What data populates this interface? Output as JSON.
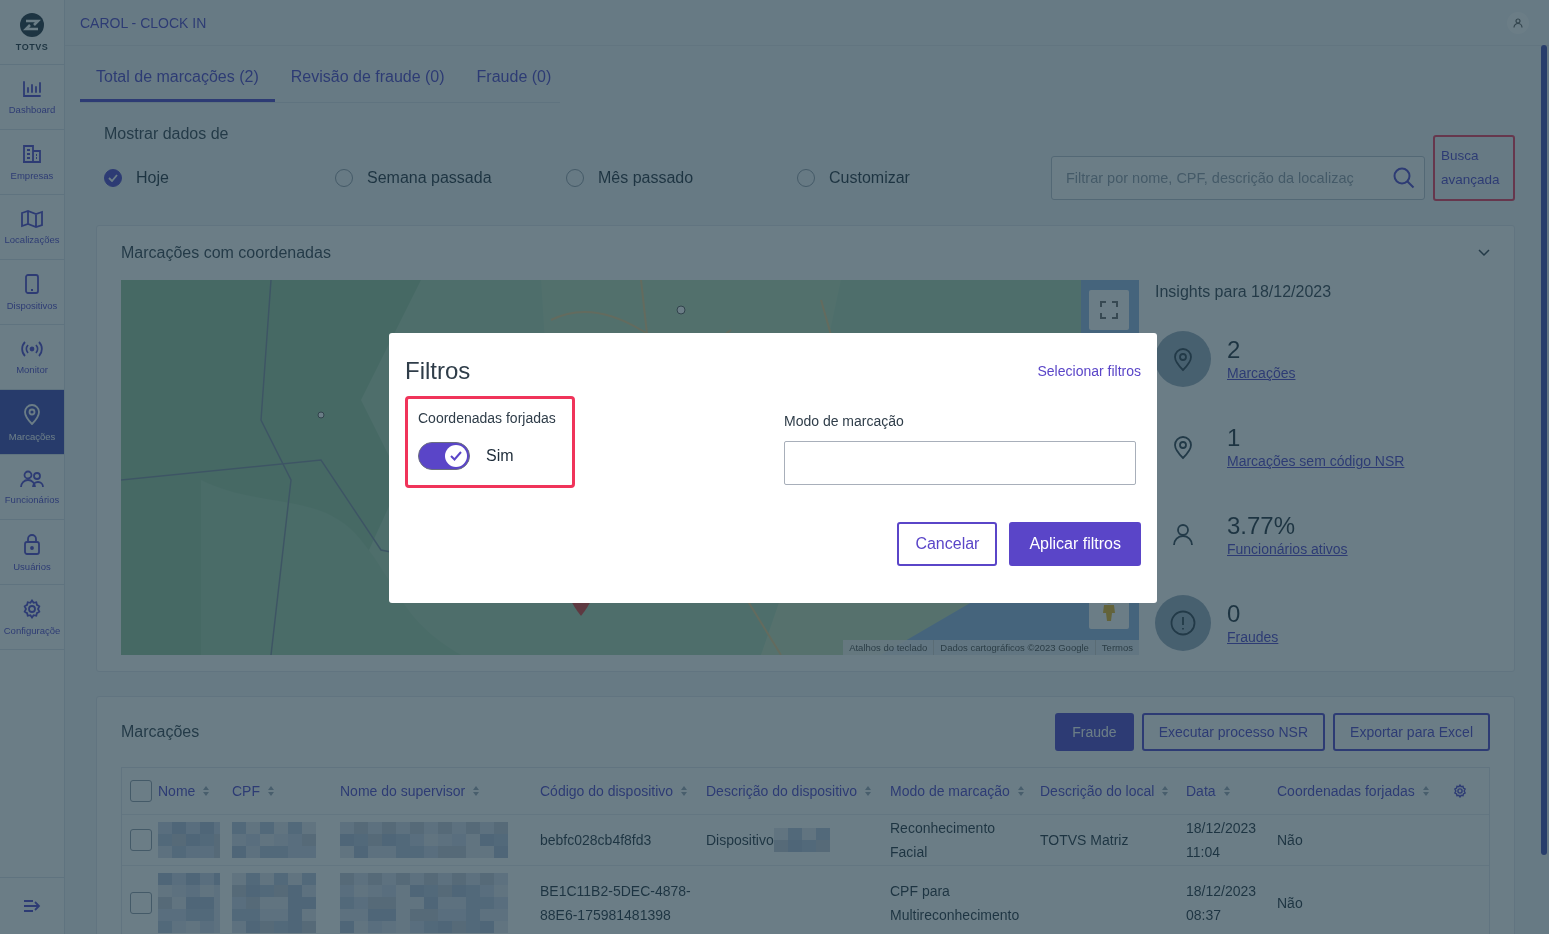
{
  "sidebar": {
    "logo": "TOTVS",
    "items": [
      {
        "label": "Dashboard",
        "kind": "chart",
        "selected": false
      },
      {
        "label": "Empresas",
        "kind": "buildings",
        "selected": false
      },
      {
        "label": "Localizações",
        "kind": "map",
        "selected": false
      },
      {
        "label": "Dispositivos",
        "kind": "phone",
        "selected": false
      },
      {
        "label": "Monitor",
        "kind": "signal",
        "selected": false
      },
      {
        "label": "Marcações",
        "kind": "pin",
        "selected": true
      },
      {
        "label": "Funcionários",
        "kind": "people",
        "selected": false
      },
      {
        "label": "Usuários",
        "kind": "lock",
        "selected": false
      },
      {
        "label": "Configuraçõe",
        "kind": "gear",
        "selected": false
      }
    ]
  },
  "header": {
    "title": "CAROL - CLOCK IN"
  },
  "tabs": [
    {
      "label": "Total de marcações (2)",
      "selected": true
    },
    {
      "label": "Revisão de fraude (0)",
      "selected": false
    },
    {
      "label": "Fraude (0)",
      "selected": false
    }
  ],
  "period": {
    "label": "Mostrar dados de",
    "options": [
      {
        "label": "Hoje",
        "selected": true
      },
      {
        "label": "Semana passada",
        "selected": false
      },
      {
        "label": "Mês passado",
        "selected": false
      },
      {
        "label": "Customizar",
        "selected": false
      }
    ]
  },
  "search": {
    "placeholder": "Filtrar por nome, CPF, descrição da localizaç"
  },
  "advanced_search": {
    "label": "Busca avançada",
    "highlighted": true
  },
  "map_panel": {
    "title": "Marcações com coordenadas",
    "expanded": true,
    "map": {
      "kind": "picture",
      "attribution": [
        "Atalhos do teclado",
        "Dados cartográficos ©2023 Google",
        "Termos"
      ]
    },
    "insights": {
      "title": "Insights para 18/12/2023",
      "items": [
        {
          "value": "2",
          "label": "Marcações",
          "kind": "pin",
          "highlighted": true
        },
        {
          "value": "1",
          "label": "Marcações sem código NSR",
          "kind": "pin",
          "highlighted": false
        },
        {
          "value": "3.77%",
          "label": "Funcionários ativos",
          "kind": "person",
          "highlighted": false
        },
        {
          "value": "0",
          "label": "Fraudes",
          "kind": "alert",
          "highlighted": true
        }
      ]
    }
  },
  "table_panel": {
    "title": "Marcações",
    "buttons": [
      {
        "label": "Fraude",
        "kind": "primary"
      },
      {
        "label": "Executar processo NSR",
        "kind": "outline"
      },
      {
        "label": "Exportar para Excel",
        "kind": "outline"
      }
    ],
    "header_checked": false,
    "columns": [
      "Nome",
      "CPF",
      "Nome do supervisor",
      "Código do dispositivo",
      "Descrição do dispositivo",
      "Modo de marcação",
      "Descrição do local",
      "Data",
      "Coordenadas forjadas"
    ],
    "rows": [
      {
        "selected": false,
        "cells": [
          {
            "kind": "blurred"
          },
          {
            "kind": "blurred"
          },
          {
            "kind": "blurred"
          },
          {
            "kind": "text",
            "text": "bebfc028cb4f8fd3"
          },
          {
            "kind": "partial",
            "text": "Dispositivo"
          },
          {
            "kind": "text",
            "text": "Reconhecimento Facial"
          },
          {
            "kind": "text",
            "text": "TOTVS Matriz"
          },
          {
            "kind": "text",
            "text": "18/12/2023 11:04"
          },
          {
            "kind": "text",
            "text": "Não"
          }
        ]
      },
      {
        "selected": false,
        "cells": [
          {
            "kind": "blurred"
          },
          {
            "kind": "blurred"
          },
          {
            "kind": "blurred"
          },
          {
            "kind": "text",
            "text": "BE1C11B2-5DEC-4878-88E6-175981481398"
          },
          {
            "kind": "empty"
          },
          {
            "kind": "text",
            "text": "CPF para Multireconhecimento"
          },
          {
            "kind": "empty"
          },
          {
            "kind": "text",
            "text": "18/12/2023 08:37"
          },
          {
            "kind": "text",
            "text": "Não"
          }
        ]
      }
    ]
  },
  "modal": {
    "title": "Filtros",
    "link": "Selecionar filtros",
    "fields": [
      {
        "kind": "toggle",
        "label": "Coordenadas forjadas",
        "on": true,
        "value_label": "Sim",
        "highlighted": true
      },
      {
        "kind": "input",
        "label": "Modo de marcação",
        "highlighted": false
      }
    ],
    "buttons": [
      {
        "label": "Cancelar",
        "kind": "outline"
      },
      {
        "label": "Aplicar filtros",
        "kind": "primary"
      }
    ]
  }
}
